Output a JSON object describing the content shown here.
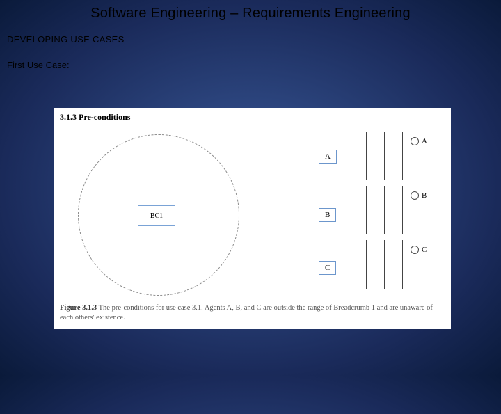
{
  "slide": {
    "title": "Software Engineering – Requirements Engineering",
    "section": "DEVELOPING USE CASES",
    "subheading": "First Use Case:"
  },
  "figure": {
    "heading": "3.1.3 Pre-conditions",
    "diamond_label": "BC1",
    "nodes": {
      "a": "A",
      "b": "B",
      "c": "C"
    },
    "agents": {
      "a": "A",
      "b": "B",
      "c": "C"
    },
    "caption_lead": "Figure 3.1.3",
    "caption_rest": "The pre-conditions for use case 3.1. Agents A, B, and C are outside the range of Breadcrumb 1 and are unaware of each others' existence."
  }
}
